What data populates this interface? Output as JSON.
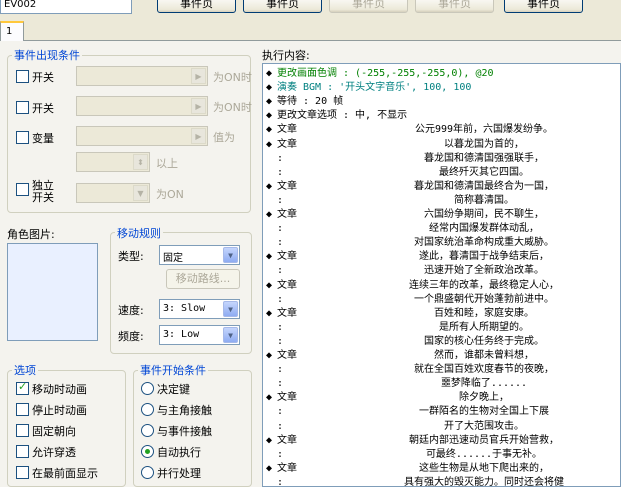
{
  "event_name": "EV002",
  "page_buttons": [
    {
      "label": "事件页",
      "disabled": false
    },
    {
      "label": "事件页",
      "disabled": false
    },
    {
      "label": "事件页",
      "disabled": true
    },
    {
      "label": "事件页",
      "disabled": true
    },
    {
      "label": "事件页",
      "disabled": false
    }
  ],
  "tab": "1",
  "conditions": {
    "title": "事件出现条件",
    "switch1": {
      "label": "开关",
      "suffix": "为ON时"
    },
    "switch2": {
      "label": "开关",
      "suffix": "为ON时"
    },
    "variable": {
      "label": "变量",
      "suffix": "值为",
      "above": "以上"
    },
    "self_switch": {
      "label": "独立\n开关",
      "suffix": "为ON"
    }
  },
  "graphic": {
    "label": "角色图片:"
  },
  "movement": {
    "title": "移动规则",
    "type_label": "类型:",
    "type_value": "固定",
    "route_button": "移动路线...",
    "speed_label": "速度:",
    "speed_value": "3: Slow",
    "freq_label": "频度:",
    "freq_value": "3: Low"
  },
  "options": {
    "title": "选项",
    "items": [
      {
        "label": "移动时动画",
        "checked": true
      },
      {
        "label": "停止时动画",
        "checked": false
      },
      {
        "label": "固定朝向",
        "checked": false
      },
      {
        "label": "允许穿透",
        "checked": false
      },
      {
        "label": "在最前面显示",
        "checked": false
      }
    ]
  },
  "trigger": {
    "title": "事件开始条件",
    "items": [
      {
        "label": "决定键",
        "checked": false
      },
      {
        "label": "与主角接触",
        "checked": false
      },
      {
        "label": "与事件接触",
        "checked": false
      },
      {
        "label": "自动执行",
        "checked": true
      },
      {
        "label": "并行处理",
        "checked": false
      }
    ]
  },
  "list_title": "执行内容:",
  "commands": [
    {
      "mark": "◆",
      "cmd": "更改画面色调 : (-255,-255,-255,0), @20",
      "text": "",
      "color": "#008000",
      "raw": true
    },
    {
      "mark": "◆",
      "cmd": "演奏 BGM : '开头文字音乐', 100, 100",
      "text": "",
      "color": "#008080",
      "raw": true
    },
    {
      "mark": "◆",
      "cmd": "等待 : 20 帧",
      "text": "",
      "color": "#000000",
      "raw": true
    },
    {
      "mark": "◆",
      "cmd": "更改文章选项 : 中, 不显示",
      "text": "",
      "color": "#000000",
      "raw": true
    },
    {
      "mark": "◆",
      "cmd": "文章",
      "text": "公元999年前，六国爆发纷争。",
      "color": "#000000"
    },
    {
      "mark": "◆",
      "cmd": "文章",
      "text": "以暮龙国为首的，",
      "color": "#000000"
    },
    {
      "mark": " ",
      "cmd": ":",
      "text": "暮龙国和德清国强强联手，",
      "color": "#000000"
    },
    {
      "mark": " ",
      "cmd": ":",
      "text": "最终歼灭其它四国。",
      "color": "#000000"
    },
    {
      "mark": "◆",
      "cmd": "文章",
      "text": "暮龙国和德清国最终合为一国，",
      "color": "#000000"
    },
    {
      "mark": " ",
      "cmd": ":",
      "text": "简称暮清国。",
      "color": "#000000"
    },
    {
      "mark": "◆",
      "cmd": "文章",
      "text": "六国纷争期间，民不聊生，",
      "color": "#000000"
    },
    {
      "mark": " ",
      "cmd": ":",
      "text": "经常内国爆发群体动乱，",
      "color": "#000000"
    },
    {
      "mark": " ",
      "cmd": ":",
      "text": "对国家统治革命构成重大威胁。",
      "color": "#000000"
    },
    {
      "mark": "◆",
      "cmd": "文章",
      "text": "遂此，暮清国于战争结束后，",
      "color": "#000000"
    },
    {
      "mark": " ",
      "cmd": ":",
      "text": "迅速开始了全新政治改革。",
      "color": "#000000"
    },
    {
      "mark": "◆",
      "cmd": "文章",
      "text": "连续三年的改革，最终稳定人心，",
      "color": "#000000"
    },
    {
      "mark": " ",
      "cmd": ":",
      "text": "一个鼎盛朝代开始蓬勃前进中。",
      "color": "#000000"
    },
    {
      "mark": "◆",
      "cmd": "文章",
      "text": "百姓和睦，家庭安康。",
      "color": "#000000"
    },
    {
      "mark": " ",
      "cmd": ":",
      "text": "是所有人所期望的。",
      "color": "#000000"
    },
    {
      "mark": " ",
      "cmd": ":",
      "text": "国家的核心任务终于完成。",
      "color": "#000000"
    },
    {
      "mark": "◆",
      "cmd": "文章",
      "text": "然而，谁都未曾料想，",
      "color": "#000000"
    },
    {
      "mark": " ",
      "cmd": ":",
      "text": "就在全国百姓欢度春节的夜晚，",
      "color": "#000000"
    },
    {
      "mark": " ",
      "cmd": ":",
      "text": "噩梦降临了......",
      "color": "#000000"
    },
    {
      "mark": "◆",
      "cmd": "文章",
      "text": "除夕晚上，",
      "color": "#000000"
    },
    {
      "mark": " ",
      "cmd": ":",
      "text": "一群陌名的生物对全国上下展",
      "color": "#000000"
    },
    {
      "mark": " ",
      "cmd": ":",
      "text": "开了大范围攻击。",
      "color": "#000000"
    },
    {
      "mark": "◆",
      "cmd": "文章",
      "text": "朝廷内部迅速动员官兵开始营救，",
      "color": "#000000"
    },
    {
      "mark": " ",
      "cmd": ":",
      "text": "可最终......于事无补。",
      "color": "#000000"
    },
    {
      "mark": "◆",
      "cmd": "文章",
      "text": "这些生物是从地下爬出来的，",
      "color": "#000000"
    },
    {
      "mark": " ",
      "cmd": ":",
      "text": "具有强大的毁灭能力。同时还会将健",
      "color": "#000000"
    }
  ]
}
